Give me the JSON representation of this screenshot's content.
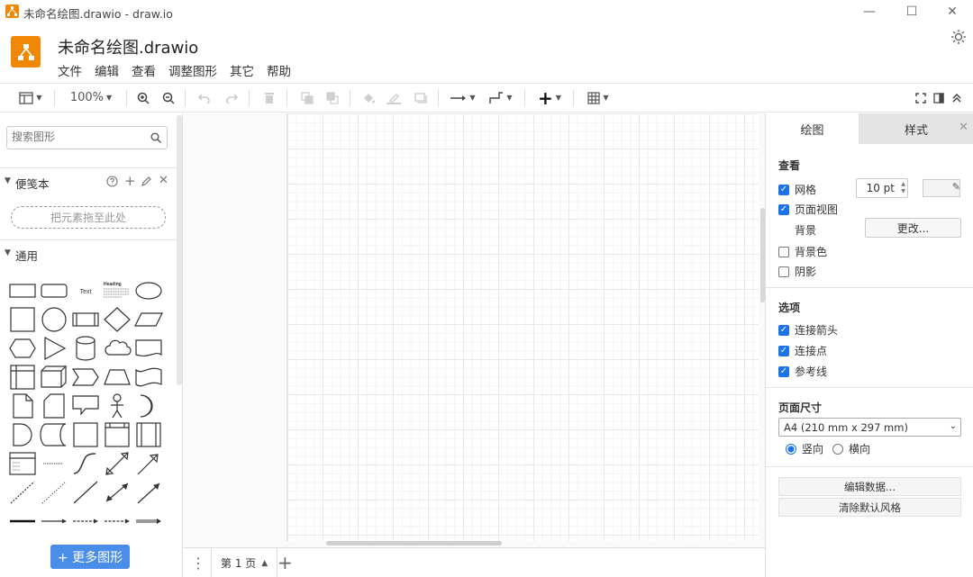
{
  "window": {
    "title": "未命名绘图.drawio - draw.io",
    "minimize": "—",
    "maximize": "☐",
    "close": "✕"
  },
  "app": {
    "doc_title": "未命名绘图.drawio",
    "menu": [
      "文件",
      "编辑",
      "查看",
      "调整图形",
      "其它",
      "帮助"
    ]
  },
  "toolbar": {
    "zoom": "100%"
  },
  "left_panel": {
    "search_placeholder": "搜索图形",
    "scratchpad_label": "便笺本",
    "drop_hint": "把元素拖至此处",
    "general_label": "通用",
    "more_shapes": "+ 更多图形",
    "shape_text_label": "Text",
    "shape_heading_label": "Heading"
  },
  "page_tabs": {
    "menu_icon": "⋮",
    "current": "第 1 页",
    "add": "+"
  },
  "right_panel": {
    "tab_diagram": "绘图",
    "tab_style": "样式",
    "close": "✕",
    "view_title": "查看",
    "grid_label": "网格",
    "grid_size": "10 pt",
    "page_view_label": "页面视图",
    "background_label": "背景",
    "change_button": "更改...",
    "bg_color_label": "背景色",
    "shadow_label": "阴影",
    "options_title": "选项",
    "connect_arrows_label": "连接箭头",
    "connection_points_label": "连接点",
    "guides_label": "参考线",
    "paper_title": "页面尺寸",
    "paper_size": "A4 (210 mm x 297 mm)",
    "portrait_label": "竖向",
    "landscape_label": "横向",
    "edit_data_button": "编辑数据...",
    "clear_style_button": "清除默认风格"
  },
  "state": {
    "grid": true,
    "page_view": true,
    "background_color": false,
    "shadow": false,
    "connect_arrows": true,
    "connection_points": true,
    "guides": true,
    "orientation": "portrait"
  },
  "colors": {
    "accent": "#1a73e8",
    "logo": "#f08705",
    "more_shapes_button": "#4a8de8"
  }
}
